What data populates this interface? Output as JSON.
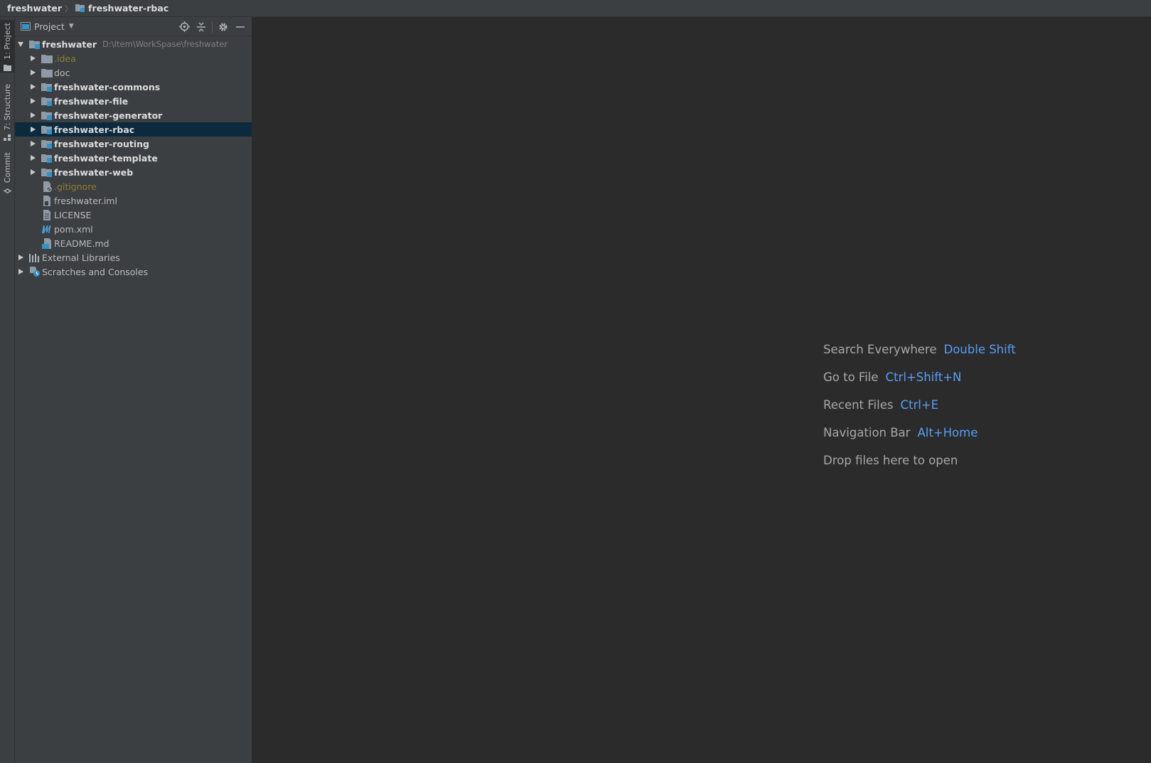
{
  "navbar": {
    "crumbs": [
      {
        "label": "freshwater"
      },
      {
        "label": "freshwater-rbac"
      }
    ]
  },
  "stripe": {
    "buttons": [
      {
        "label": "1: Project",
        "active": true
      },
      {
        "label": "7: Structure",
        "active": false
      },
      {
        "label": "Commit",
        "active": false
      }
    ]
  },
  "project_panel": {
    "title": "Project",
    "tools": [
      "locate-icon",
      "collapse-all-icon",
      "gear-icon",
      "minimize-icon"
    ],
    "root": {
      "label": "freshwater",
      "path": "D:\\Item\\WorkSpase\\freshwater"
    },
    "items": [
      {
        "label": ".idea"
      },
      {
        "label": "doc"
      },
      {
        "label": "freshwater-commons"
      },
      {
        "label": "freshwater-file"
      },
      {
        "label": "freshwater-generator"
      },
      {
        "label": "freshwater-rbac"
      },
      {
        "label": "freshwater-routing"
      },
      {
        "label": "freshwater-template"
      },
      {
        "label": "freshwater-web"
      },
      {
        "label": ".gitignore"
      },
      {
        "label": "freshwater.iml"
      },
      {
        "label": "LICENSE"
      },
      {
        "label": "pom.xml"
      },
      {
        "label": "README.md"
      }
    ],
    "external_libraries": "External Libraries",
    "scratches": "Scratches and Consoles"
  },
  "editor": {
    "hints": [
      {
        "text": "Search Everywhere",
        "key": "Double Shift"
      },
      {
        "text": "Go to File",
        "key": "Ctrl+Shift+N"
      },
      {
        "text": "Recent Files",
        "key": "Ctrl+E"
      },
      {
        "text": "Navigation Bar",
        "key": "Alt+Home"
      },
      {
        "text": "Drop files here to open",
        "key": ""
      }
    ]
  },
  "colors": {
    "accent": "#589df6",
    "selection": "#0d293e",
    "ignored_file": "#8c7d33",
    "module_badge": "#3592c4"
  }
}
